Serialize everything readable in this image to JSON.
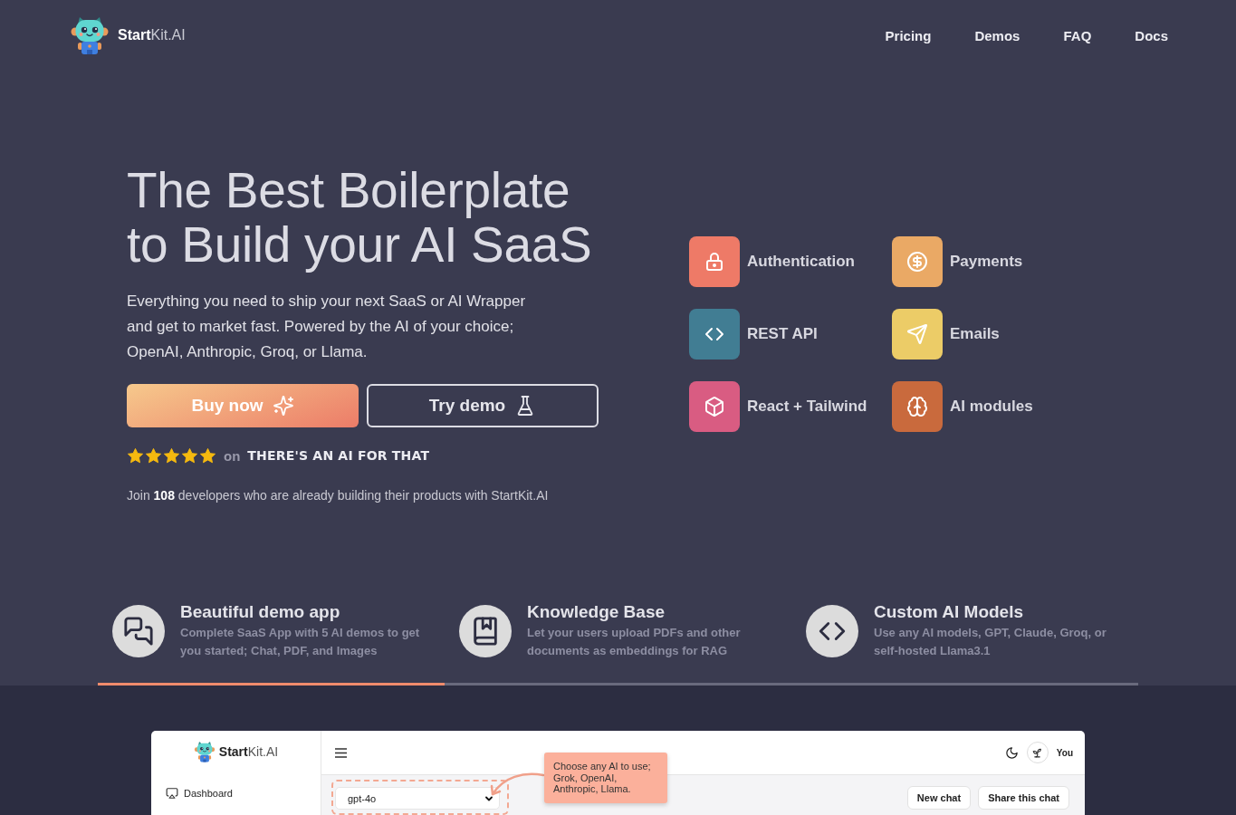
{
  "nav": {
    "brand": "**Start**Kit.AI",
    "links": [
      "Pricing",
      "Demos",
      "FAQ",
      "Docs"
    ]
  },
  "hero": {
    "title": "The Best Boilerplate to Build your AI SaaS",
    "description": "Everything you need to ship your next SaaS or AI Wrapper and get to market fast. Powered by the AI of your choice; OpenAI, Anthropic, Groq, or Llama.",
    "buttons": [
      {
        "label": "Buy now",
        "kind": "primary"
      },
      {
        "label": "Try demo",
        "kind": "outline"
      }
    ],
    "rating": {
      "stars": 5,
      "on": "on",
      "site": "THERE'S AN AI FOR THAT"
    },
    "social_proof": "Join **108** developers who are already building their products with StartKit.AI"
  },
  "features": [
    {
      "label": "Authentication",
      "color": "#ee7a67"
    },
    {
      "label": "Payments",
      "color": "#eaa965"
    },
    {
      "label": "REST API",
      "color": "#417d93"
    },
    {
      "label": "Emails",
      "color": "#eccc67"
    },
    {
      "label": "React + Tailwind",
      "color": "#d95c82"
    },
    {
      "label": "AI modules",
      "color": "#c96a3d"
    }
  ],
  "highlights": [
    {
      "title": "Beautiful demo app",
      "description": "Complete SaaS App with 5 AI demos to get you started; Chat, PDF, and Images",
      "selected": true
    },
    {
      "title": "Knowledge Base",
      "description": "Let your users upload PDFs and other documents as embeddings for RAG",
      "selected": false
    },
    {
      "title": "Custom AI Models",
      "description": "Use any AI models, GPT, Claude, Groq, or self-hosted Llama3.1",
      "selected": false
    }
  ],
  "demo_app": {
    "brand": "**Start**Kit.AI",
    "sidebar_items": [
      "Dashboard"
    ],
    "user": "You",
    "model_select": {
      "value": "gpt-4o"
    },
    "callout": "Choose any AI to use; Grok, OpenAI, Anthropic, Llama.",
    "buttons": [
      "New chat",
      "Share this chat"
    ]
  }
}
